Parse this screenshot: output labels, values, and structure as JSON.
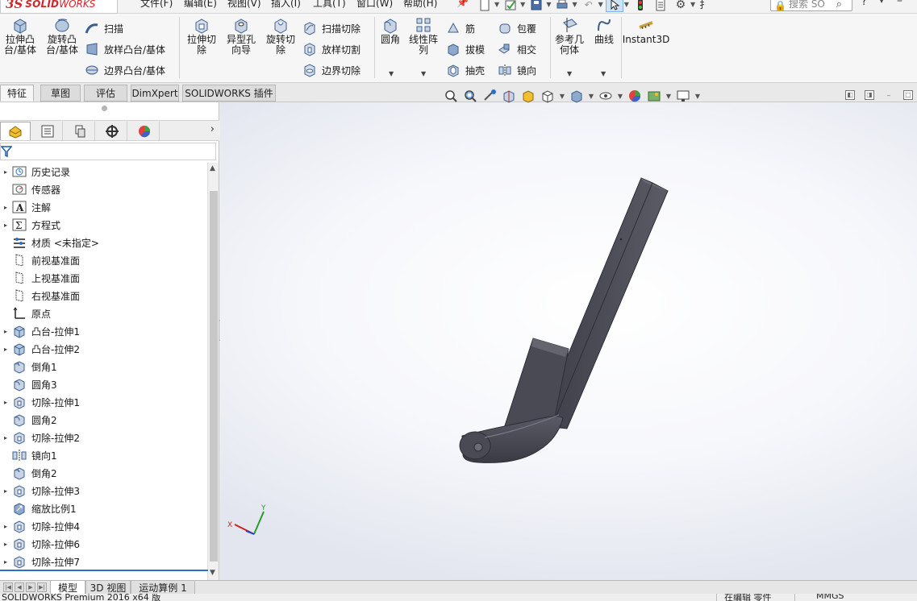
{
  "app": {
    "brand_ds": "3S",
    "brand_solid": "SOLID",
    "brand_works": "WORKS"
  },
  "menu": [
    {
      "label": "文件(F)"
    },
    {
      "label": "编辑(E)"
    },
    {
      "label": "视图(V)"
    },
    {
      "label": "插入(I)"
    },
    {
      "label": "工具(T)"
    },
    {
      "label": "窗口(W)"
    },
    {
      "label": "帮助(H)"
    }
  ],
  "search": {
    "placeholder": "搜索 SO",
    "user_glyph": "扌"
  },
  "help_label": "?",
  "ribbon": {
    "extrude_boss": "拉伸凸台/基体",
    "revolve_boss": "旋转凸台/基体",
    "sweep": "扫描",
    "loft_boss": "放样凸台/基体",
    "boundary_boss": "边界凸台/基体",
    "extrude_cut": "拉伸切除",
    "hole_wizard": "异型孔向导",
    "revolve_cut": "旋转切除",
    "swept_cut": "扫描切除",
    "lofted_cut": "放样切割",
    "boundary_cut": "边界切除",
    "fillet": "圆角",
    "linear_pattern": "线性阵列",
    "rib": "筋",
    "draft": "拔模",
    "shell": "抽壳",
    "wrap": "包覆",
    "intersect": "相交",
    "mirror": "镜向",
    "reference_geometry": "参考几何体",
    "curves": "曲线",
    "instant3d": "Instant3D"
  },
  "tabs": [
    {
      "label": "特征",
      "active": true
    },
    {
      "label": "草图",
      "active": false
    },
    {
      "label": "评估",
      "active": false
    },
    {
      "label": "DimXpert",
      "active": false
    },
    {
      "label": "SOLIDWORKS 插件",
      "active": false
    }
  ],
  "tree": [
    {
      "label": "历史记录",
      "icon": "history-icon",
      "expandable": true
    },
    {
      "label": "传感器",
      "icon": "sensor-icon",
      "expandable": false
    },
    {
      "label": "注解",
      "icon": "annotation-icon",
      "expandable": true
    },
    {
      "label": "方程式",
      "icon": "equation-icon",
      "expandable": true
    },
    {
      "label": "材质 <未指定>",
      "icon": "material-icon",
      "expandable": false
    },
    {
      "label": "前视基准面",
      "icon": "plane-icon",
      "expandable": false
    },
    {
      "label": "上视基准面",
      "icon": "plane-icon",
      "expandable": false
    },
    {
      "label": "右视基准面",
      "icon": "plane-icon",
      "expandable": false
    },
    {
      "label": "原点",
      "icon": "origin-icon",
      "expandable": false
    },
    {
      "label": "凸台-拉伸1",
      "icon": "boss-extrude-icon",
      "expandable": true
    },
    {
      "label": "凸台-拉伸2",
      "icon": "boss-extrude-icon",
      "expandable": true
    },
    {
      "label": "倒角1",
      "icon": "chamfer-icon",
      "expandable": false
    },
    {
      "label": "圆角3",
      "icon": "fillet-icon",
      "expandable": false
    },
    {
      "label": "切除-拉伸1",
      "icon": "cut-extrude-icon",
      "expandable": true
    },
    {
      "label": "圆角2",
      "icon": "fillet-icon",
      "expandable": false
    },
    {
      "label": "切除-拉伸2",
      "icon": "cut-extrude-icon",
      "expandable": true
    },
    {
      "label": "镜向1",
      "icon": "mirror-feature-icon",
      "expandable": false
    },
    {
      "label": "倒角2",
      "icon": "chamfer-icon",
      "expandable": false
    },
    {
      "label": "切除-拉伸3",
      "icon": "cut-extrude-icon",
      "expandable": true
    },
    {
      "label": "缩放比例1",
      "icon": "scale-icon",
      "expandable": false
    },
    {
      "label": "切除-拉伸4",
      "icon": "cut-extrude-icon",
      "expandable": true
    },
    {
      "label": "切除-拉伸6",
      "icon": "cut-extrude-icon",
      "expandable": true
    },
    {
      "label": "切除-拉伸7",
      "icon": "cut-extrude-icon",
      "expandable": true
    }
  ],
  "bottom_tabs": [
    {
      "label": "模型",
      "active": true
    },
    {
      "label": "3D 视图",
      "active": false
    },
    {
      "label": "运动算例 1",
      "active": false
    }
  ],
  "triad": {
    "x": "X",
    "y": "Y"
  },
  "status": {
    "version": "SOLIDWORKS Premium 2016 x64 版",
    "mode": "在编辑 零件",
    "units": "MMGS"
  },
  "colors": {
    "brand_red": "#d6242b",
    "part_body": "#4a4a55",
    "selection_blue": "#2a6fcf"
  }
}
